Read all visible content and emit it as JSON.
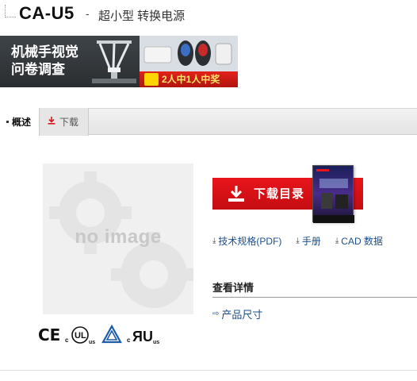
{
  "header": {
    "model": "CA-U5",
    "separator": "-",
    "subtitle": "超小型 转换电源"
  },
  "banner": {
    "line1": "机械手视觉",
    "line2": "问卷调查",
    "prize_text": "2人中1人中奖"
  },
  "tabs": [
    {
      "label": "概述"
    },
    {
      "label": "下载"
    }
  ],
  "product_image": {
    "placeholder_text": "no image"
  },
  "certifications": [
    {
      "label": "CE"
    },
    {
      "label": "cULus"
    },
    {
      "label": "TÜV"
    },
    {
      "label": "cRUus"
    }
  ],
  "download_button": {
    "label": "下载目录"
  },
  "doc_links": [
    {
      "label": "技术规格(PDF)"
    },
    {
      "label": "手册"
    },
    {
      "label": "CAD 数据"
    }
  ],
  "details": {
    "title": "查看详情",
    "link": "产品尺寸"
  },
  "colors": {
    "accent_red": "#d8161b",
    "link_blue": "#1a4f8b"
  }
}
